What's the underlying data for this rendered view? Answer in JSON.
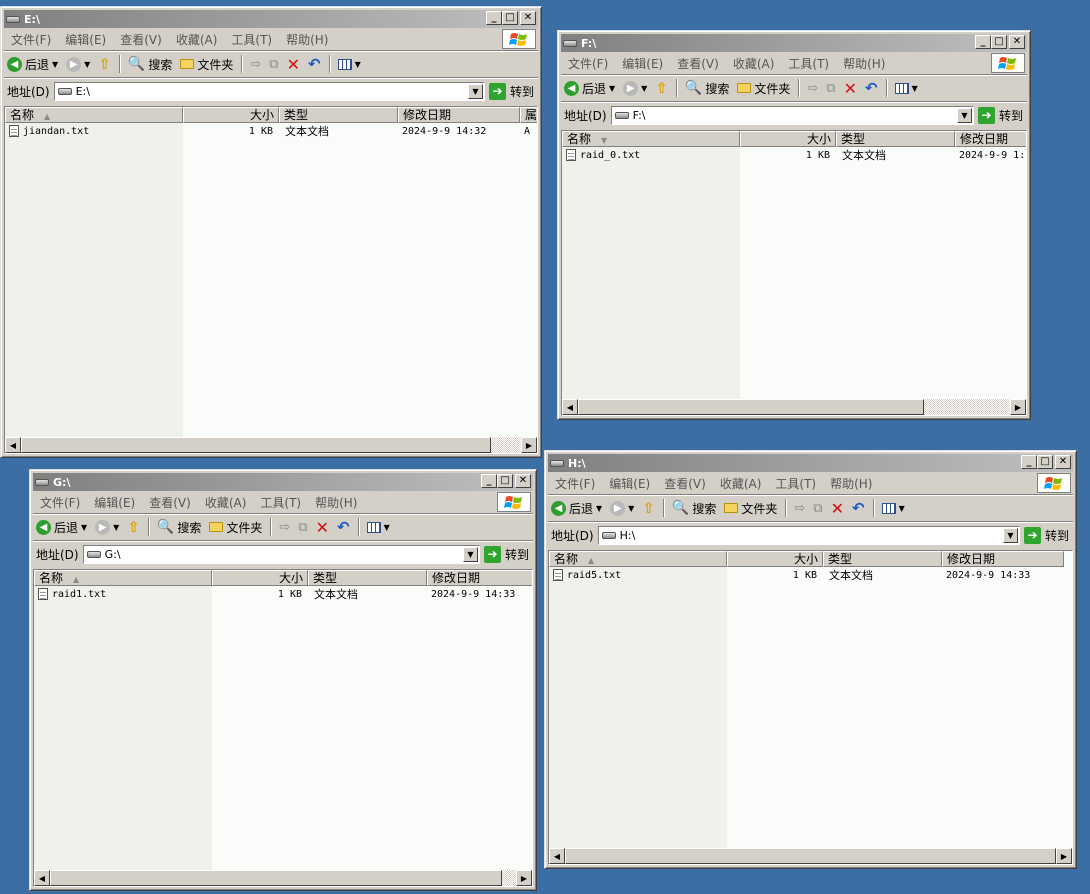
{
  "menu": [
    "文件(F)",
    "编辑(E)",
    "查看(V)",
    "收藏(A)",
    "工具(T)",
    "帮助(H)"
  ],
  "toolbar": {
    "back": "后退",
    "search": "搜索",
    "folders": "文件夹"
  },
  "address": {
    "label": "地址(D)",
    "go": "转到"
  },
  "columns": {
    "name": "名称",
    "size": "大小",
    "type": "类型",
    "date": "修改日期",
    "attr": "属"
  },
  "windows": {
    "e": {
      "title": "E:\\",
      "address": "E:\\",
      "files": [
        {
          "name": "jiandan.txt",
          "size": "1 KB",
          "type": "文本文档",
          "date": "2024-9-9 14:32",
          "attr": "A"
        }
      ]
    },
    "f": {
      "title": "F:\\",
      "address": "F:\\",
      "files": [
        {
          "name": "raid_0.txt",
          "size": "1 KB",
          "type": "文本文档",
          "date": "2024-9-9 1:"
        }
      ]
    },
    "g": {
      "title": "G:\\",
      "address": "G:\\",
      "files": [
        {
          "name": "raid1.txt",
          "size": "1 KB",
          "type": "文本文档",
          "date": "2024-9-9 14:33"
        }
      ]
    },
    "h": {
      "title": "H:\\",
      "address": "H:\\",
      "files": [
        {
          "name": "raid5.txt",
          "size": "1 KB",
          "type": "文本文档",
          "date": "2024-9-9 14:33"
        }
      ]
    }
  }
}
